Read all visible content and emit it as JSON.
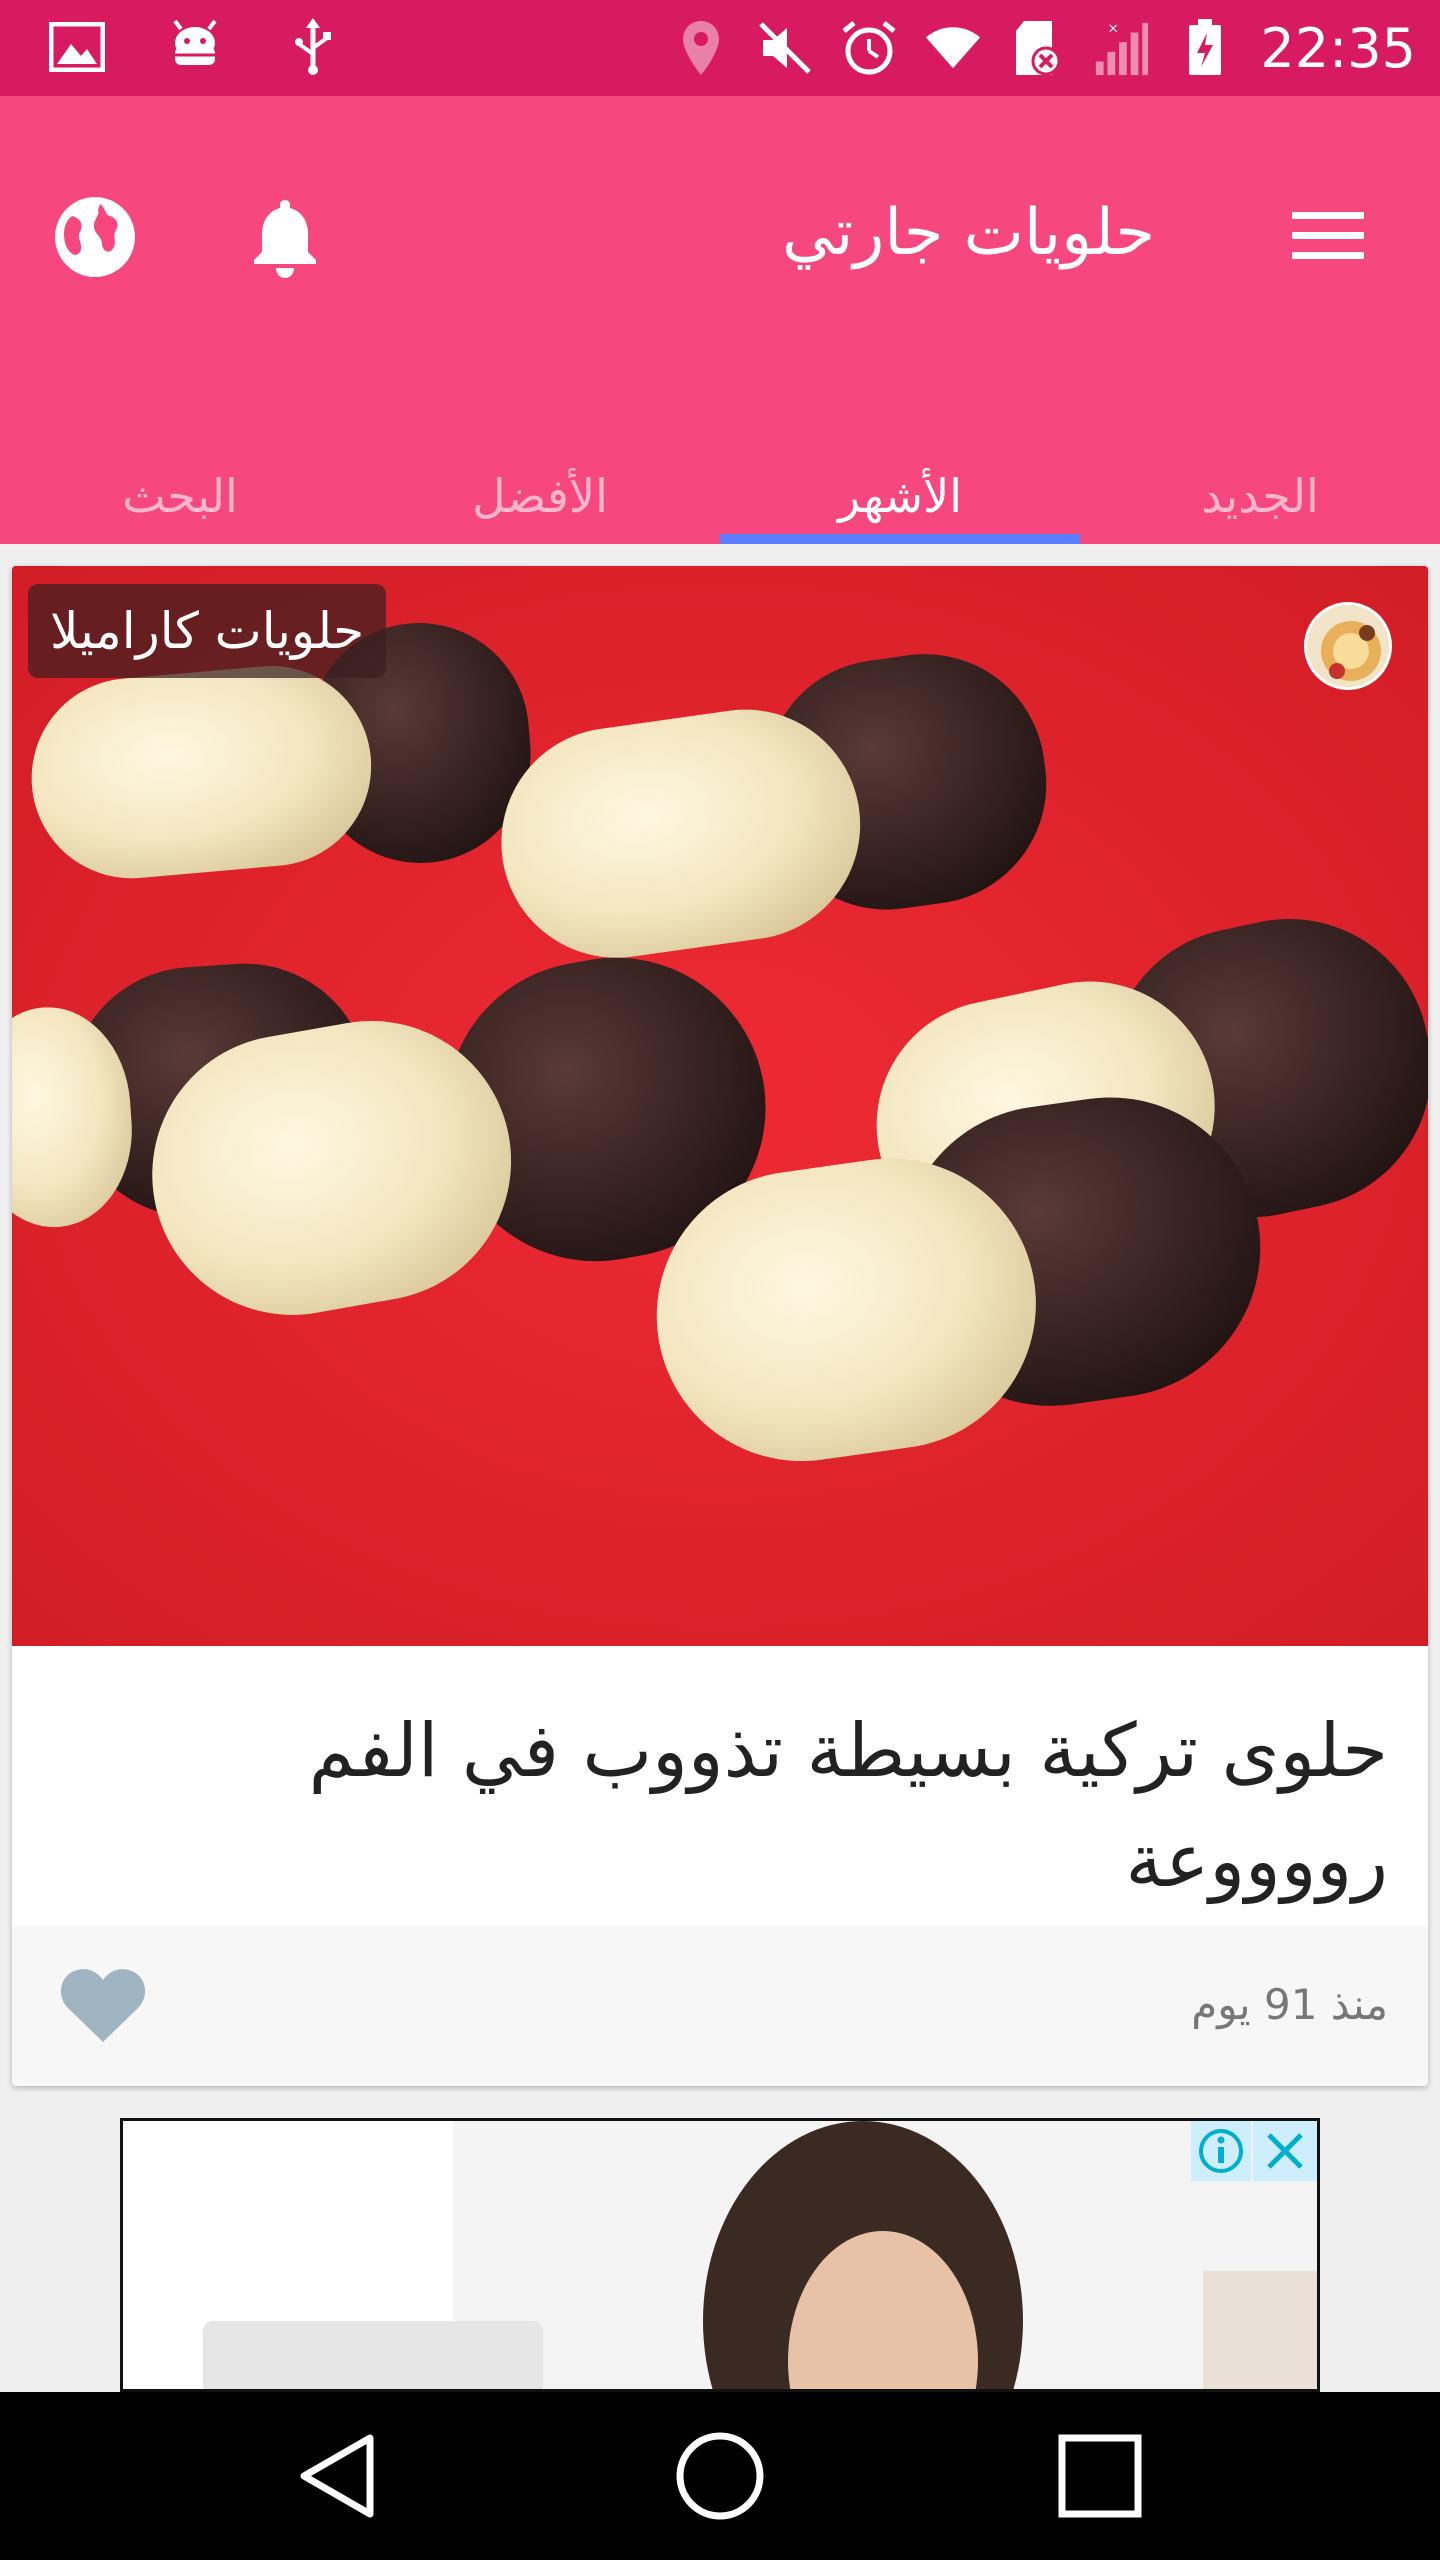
{
  "status_bar": {
    "time": "22:35",
    "left_icons": [
      "gallery-icon",
      "android-debug-icon",
      "usb-icon"
    ],
    "right_icons": [
      "location-icon",
      "mute-icon",
      "alarm-icon",
      "wifi-icon",
      "sd-card-error-icon",
      "signal-icon",
      "battery-charging-icon"
    ]
  },
  "app_bar": {
    "title": "حلويات جارتي",
    "menu_icon": "hamburger-menu-icon",
    "notification_icon": "bell-icon",
    "language_icon": "globe-icon"
  },
  "tabs": [
    {
      "label": "الجديد",
      "active": false
    },
    {
      "label": "الأشهر",
      "active": true
    },
    {
      "label": "الأفضل",
      "active": false
    },
    {
      "label": "البحث",
      "active": false
    }
  ],
  "card": {
    "category": "حلويات كاراميلا",
    "title": "حلوى تركية بسيطة تذووب في الفم رووووعة",
    "time_ago": "منذ 91 يوم",
    "favorite_icon": "heart-icon"
  },
  "ad": {
    "info_icon": "info-icon",
    "close_icon": "close-icon"
  },
  "nav_bar": [
    "back-icon",
    "home-icon",
    "recents-icon"
  ],
  "colors": {
    "status_bar": "#d81b60",
    "app_bar": "#f7477f",
    "tab_indicator": "#5a7cff",
    "image_background": "#e52530"
  }
}
